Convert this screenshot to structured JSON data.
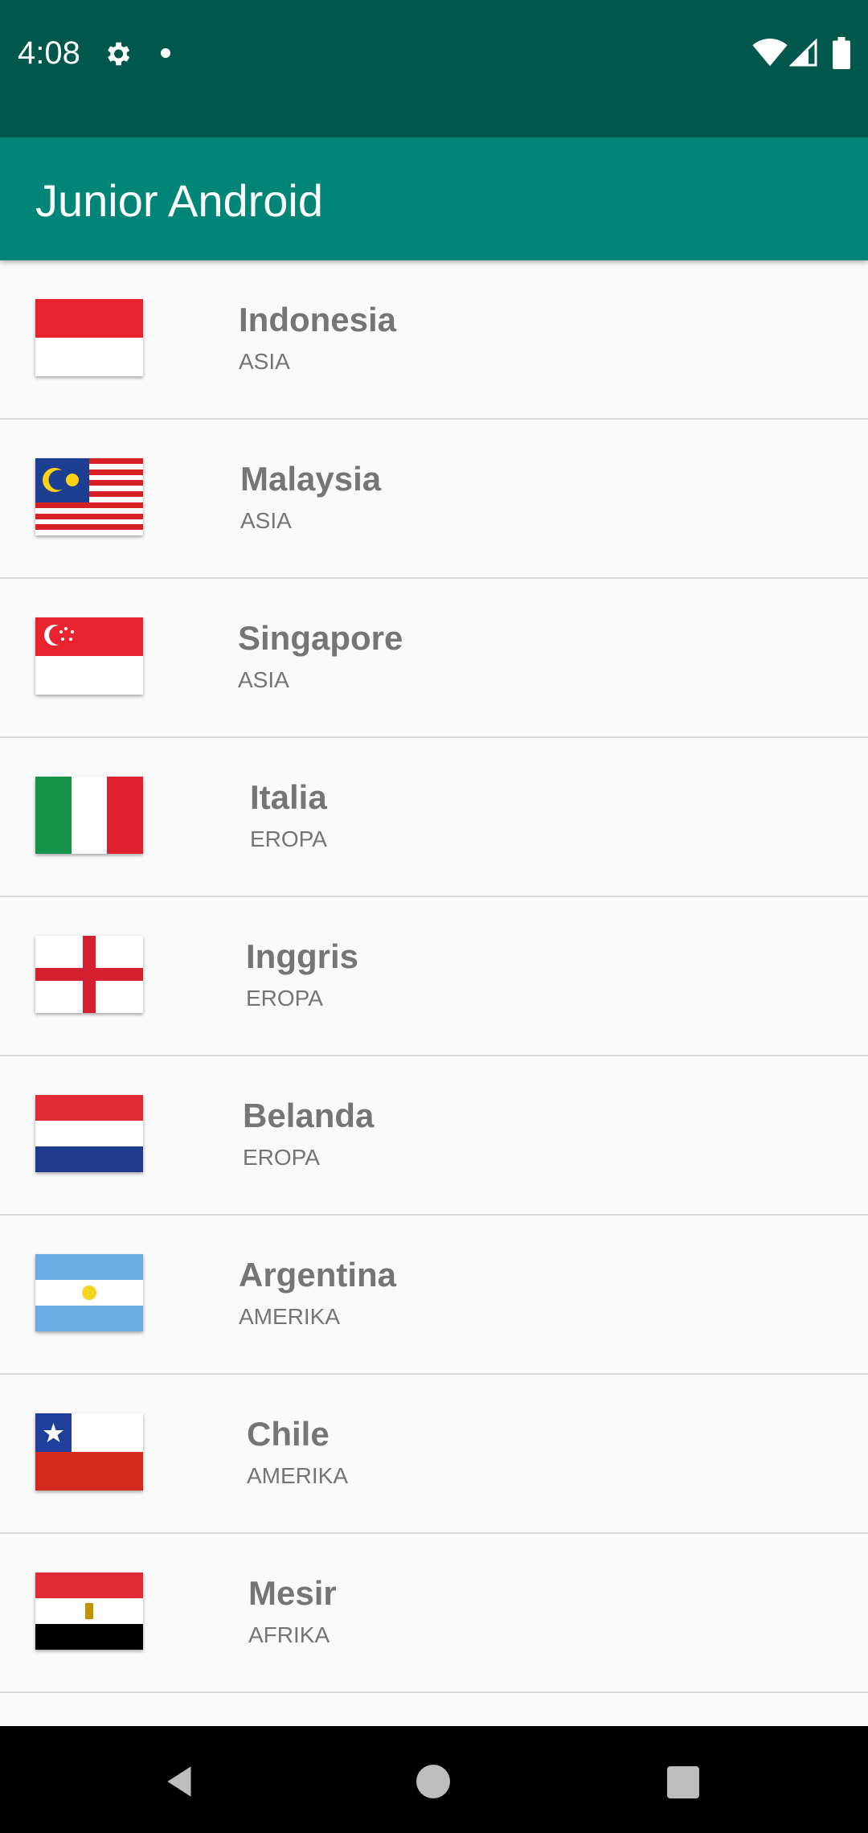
{
  "status_bar": {
    "time": "4:08"
  },
  "app_bar": {
    "title": "Junior Android"
  },
  "countries": [
    {
      "name": "Indonesia",
      "region": "ASIA"
    },
    {
      "name": "Malaysia",
      "region": "ASIA"
    },
    {
      "name": "Singapore",
      "region": "ASIA"
    },
    {
      "name": "Italia",
      "region": "EROPA"
    },
    {
      "name": "Inggris",
      "region": "EROPA"
    },
    {
      "name": "Belanda",
      "region": "EROPA"
    },
    {
      "name": "Argentina",
      "region": "AMERIKA"
    },
    {
      "name": "Chile",
      "region": "AMERIKA"
    },
    {
      "name": "Mesir",
      "region": "AFRIKA"
    }
  ],
  "colors": {
    "status_bar": "#00574b",
    "app_bar": "#008577",
    "text_secondary": "#757575"
  }
}
